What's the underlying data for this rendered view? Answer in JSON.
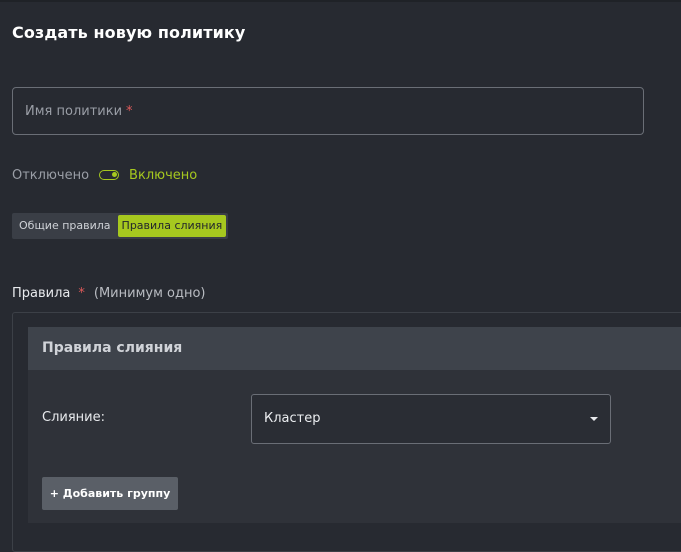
{
  "page": {
    "title": "Создать новую политику"
  },
  "form": {
    "name_field": {
      "label": "Имя политики",
      "required_mark": "*"
    },
    "status_toggle": {
      "off_label": "Отключено",
      "on_label": "Включено",
      "enabled": true
    }
  },
  "tabs": [
    {
      "label": "Общие правила",
      "active": false
    },
    {
      "label": "Правила слияния",
      "active": true
    }
  ],
  "rules": {
    "heading": "Правила",
    "required_mark": "*",
    "hint": "(Минимум одно)",
    "merge_panel": {
      "title": "Правила слияния",
      "merge_label": "Слияние:",
      "merge_select_value": "Кластер",
      "add_group_label": "+ Добавить группу"
    }
  },
  "colors": {
    "accent": "#a6c81f",
    "background": "#272a31",
    "required": "#e05a5a"
  },
  "icons": {
    "select_caret": "chevron-down-icon",
    "toggle": "toggle-switch-icon"
  }
}
